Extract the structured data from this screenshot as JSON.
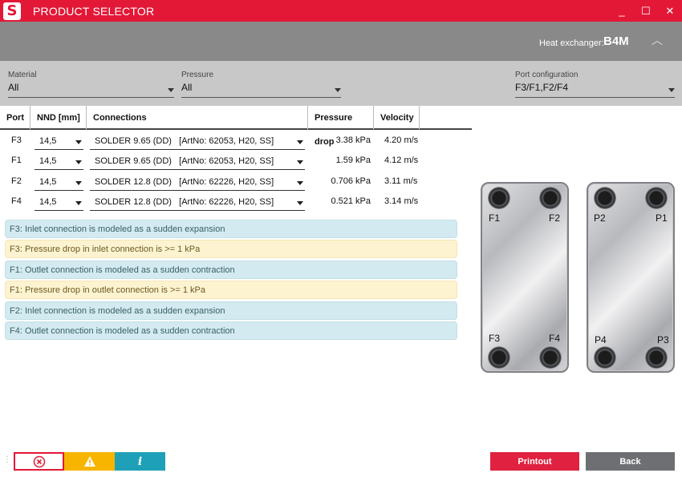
{
  "app": {
    "logo_letter": "S",
    "title": "PRODUCT SELECTOR",
    "controls": {
      "minimize": "_",
      "maximize": "☐",
      "close": "✕"
    }
  },
  "header": {
    "label": "Heat exchanger:",
    "value": "B4M",
    "collapse_glyph": "︿"
  },
  "filters": {
    "material": {
      "label": "Material",
      "value": "All"
    },
    "pressure": {
      "label": "Pressure",
      "value": "All"
    },
    "port_config": {
      "label": "Port configuration",
      "value": "F3/F1,F2/F4"
    }
  },
  "table": {
    "headers": {
      "port": "Port",
      "nnd": "NND [mm]",
      "connections": "Connections",
      "pressure_drop": "Pressure drop",
      "velocity": "Velocity"
    },
    "rows": [
      {
        "port": "F3",
        "nnd": "14,5",
        "connection": "SOLDER 9.65 (DD)   [ArtNo: 62053, H20, SS]",
        "pressure_drop": "3.38 kPa",
        "velocity": "4.20 m/s"
      },
      {
        "port": "F1",
        "nnd": "14,5",
        "connection": "SOLDER 9.65 (DD)   [ArtNo: 62053, H20, SS]",
        "pressure_drop": "1.59 kPa",
        "velocity": "4.12 m/s"
      },
      {
        "port": "F2",
        "nnd": "14,5",
        "connection": "SOLDER 12.8 (DD)   [ArtNo: 62226, H20, SS]",
        "pressure_drop": "0.706 kPa",
        "velocity": "3.11 m/s"
      },
      {
        "port": "F4",
        "nnd": "14,5",
        "connection": "SOLDER 12.8 (DD)   [ArtNo: 62226, H20, SS]",
        "pressure_drop": "0.521 kPa",
        "velocity": "3.14 m/s"
      }
    ]
  },
  "messages": [
    {
      "type": "info",
      "text": "F3: Inlet connection is modeled as a sudden expansion"
    },
    {
      "type": "warn",
      "text": "F3: Pressure drop in inlet connection is >= 1 kPa"
    },
    {
      "type": "info",
      "text": "F1: Outlet connection is modeled as a sudden contraction"
    },
    {
      "type": "warn",
      "text": "F1: Pressure drop in outlet connection is >= 1 kPa"
    },
    {
      "type": "info",
      "text": "F2: Inlet connection is modeled as a sudden expansion"
    },
    {
      "type": "info",
      "text": "F4: Outlet connection is modeled as a sudden contraction"
    }
  ],
  "diagram": {
    "front": {
      "top_left": "F1",
      "top_right": "F2",
      "bottom_left": "F3",
      "bottom_right": "F4"
    },
    "back": {
      "top_left": "P2",
      "top_right": "P1",
      "bottom_left": "P4",
      "bottom_right": "P3"
    }
  },
  "footer": {
    "dots": "⋮",
    "severity": {
      "error_icon": "error-circle-icon",
      "warning_icon": "warning-triangle-icon",
      "info_glyph": "i"
    },
    "printout_label": "Printout",
    "back_label": "Back"
  },
  "colors": {
    "brand_red": "#e31837",
    "header_gray": "#898989",
    "filter_gray": "#c8c8c8",
    "info_bg": "#d3eaf0",
    "warn_bg": "#fdf3d0",
    "warn_yellow": "#f7b500",
    "info_teal": "#1ea1b8",
    "back_gray": "#6e6f73"
  }
}
